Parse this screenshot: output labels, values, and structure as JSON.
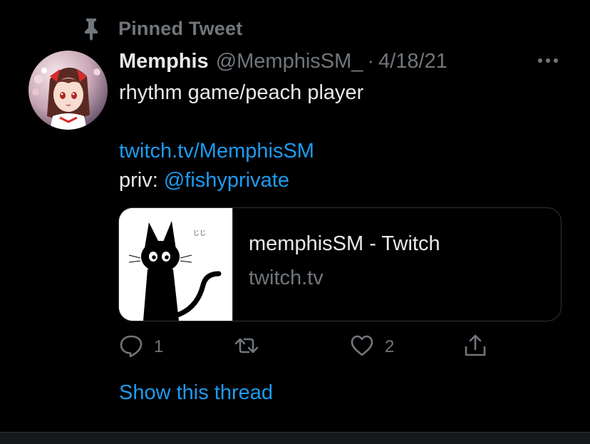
{
  "pinned": {
    "label": "Pinned Tweet",
    "icon": "pin-icon"
  },
  "tweet": {
    "display_name": "Memphis",
    "handle": "@MemphisSM_",
    "separator": "·",
    "date": "4/18/21",
    "more_icon": "more-horizontal-icon",
    "body": {
      "bio_line": "rhythm game/peach player",
      "twitch_link": "twitch.tv/MemphisSM",
      "priv_prefix": "priv: ",
      "priv_mention": "@fishyprivate"
    },
    "card": {
      "title": "memphisSM - Twitch",
      "domain": "twitch.tv",
      "thumb_caption": "じじ"
    },
    "actions": {
      "reply_count": "1",
      "retweet_count": "",
      "like_count": "2"
    },
    "show_thread": "Show this thread"
  },
  "colors": {
    "background": "#000000",
    "primary_text": "#e7e9ea",
    "secondary_text": "#71767b",
    "link": "#1d9bf0",
    "border": "#2f3336"
  }
}
